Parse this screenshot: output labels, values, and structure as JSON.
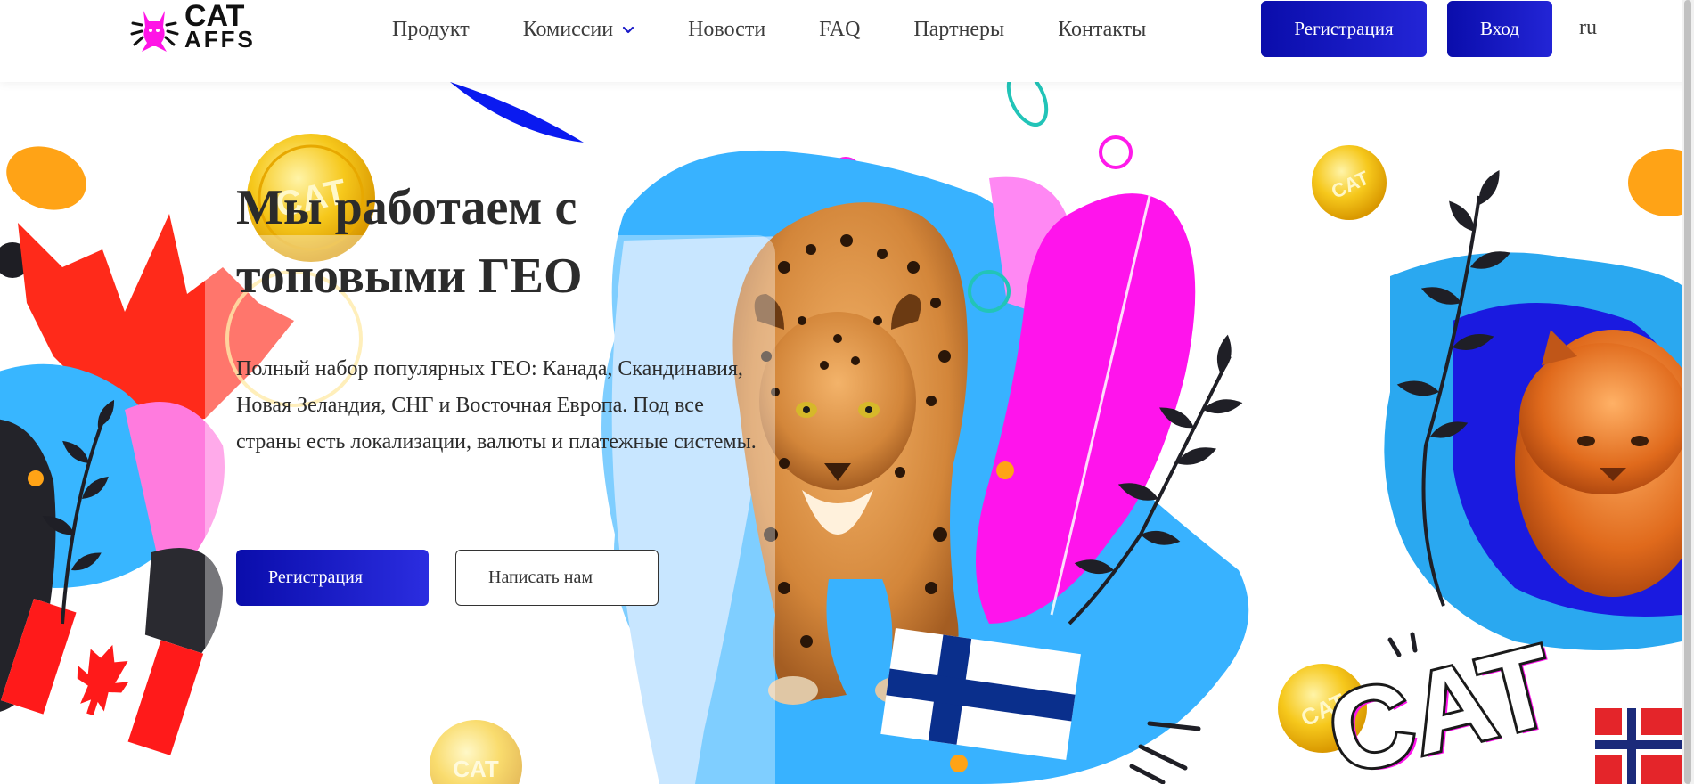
{
  "logo": {
    "line1": "CAT",
    "line2": "AFFS"
  },
  "nav": {
    "items": [
      {
        "label": "Продукт"
      },
      {
        "label": "Комиссии"
      },
      {
        "label": "Новости"
      },
      {
        "label": "FAQ"
      },
      {
        "label": "Партнеры"
      },
      {
        "label": "Контакты"
      }
    ]
  },
  "header": {
    "register_label": "Регистрация",
    "login_label": "Вход",
    "language": "ru"
  },
  "hero": {
    "title": "Мы работаем с топовыми ГЕО",
    "description": "Полный набор популярных ГЕО: Канада, Скандинавия, Новая Зеландия, СНГ и Восточная Европа. Под все страны есть локализации, валюты и платежные системы.",
    "register_label": "Регистрация",
    "contact_label": "Написать нам",
    "coin_text": "CAT",
    "sign_text": "CAT"
  },
  "colors": {
    "accent": "#1010b8",
    "magenta": "#ff10f0",
    "sky": "#3bb0ff",
    "text": "#2b2b2b"
  }
}
